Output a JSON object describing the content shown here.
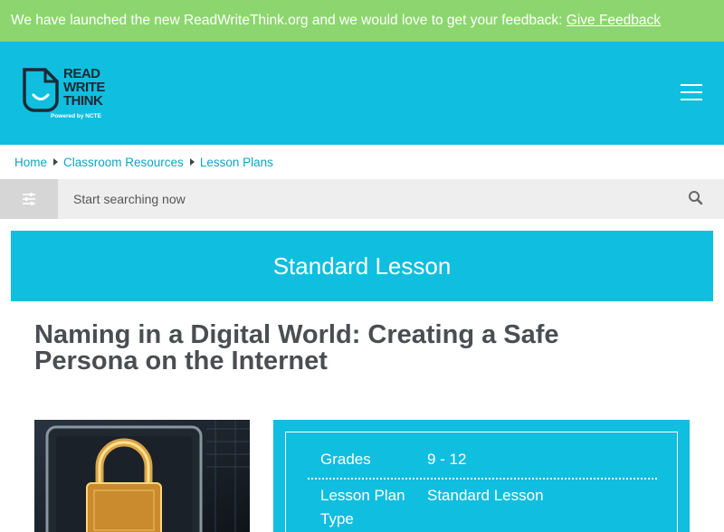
{
  "banner": {
    "text": "We have launched the new ReadWriteThink.org and we would love to get your feedback: ",
    "link_label": "Give Feedback"
  },
  "header": {
    "logo": {
      "line1": "READ",
      "line2": "WRITE",
      "line3": "THINK",
      "tagline": "Powered by NCTE"
    },
    "menu_icon": "hamburger-icon"
  },
  "breadcrumb": {
    "items": [
      "Home",
      "Classroom Resources",
      "Lesson Plans"
    ]
  },
  "search": {
    "placeholder": "Start searching now",
    "filter_icon": "sliders-icon",
    "search_icon": "magnifier-icon"
  },
  "lesson_type_banner": "Standard Lesson",
  "title": "Naming in a Digital World: Creating a Safe Persona on the Internet",
  "info": {
    "grades_label": "Grades",
    "grades_value": "9 - 12",
    "plan_type_label": "Lesson Plan Type",
    "plan_type_value": "Standard Lesson"
  },
  "colors": {
    "banner_green": "#8dd66f",
    "brand_cyan": "#10bedf",
    "link_blue": "#10a4c2",
    "text_dark": "#4a4e52"
  }
}
